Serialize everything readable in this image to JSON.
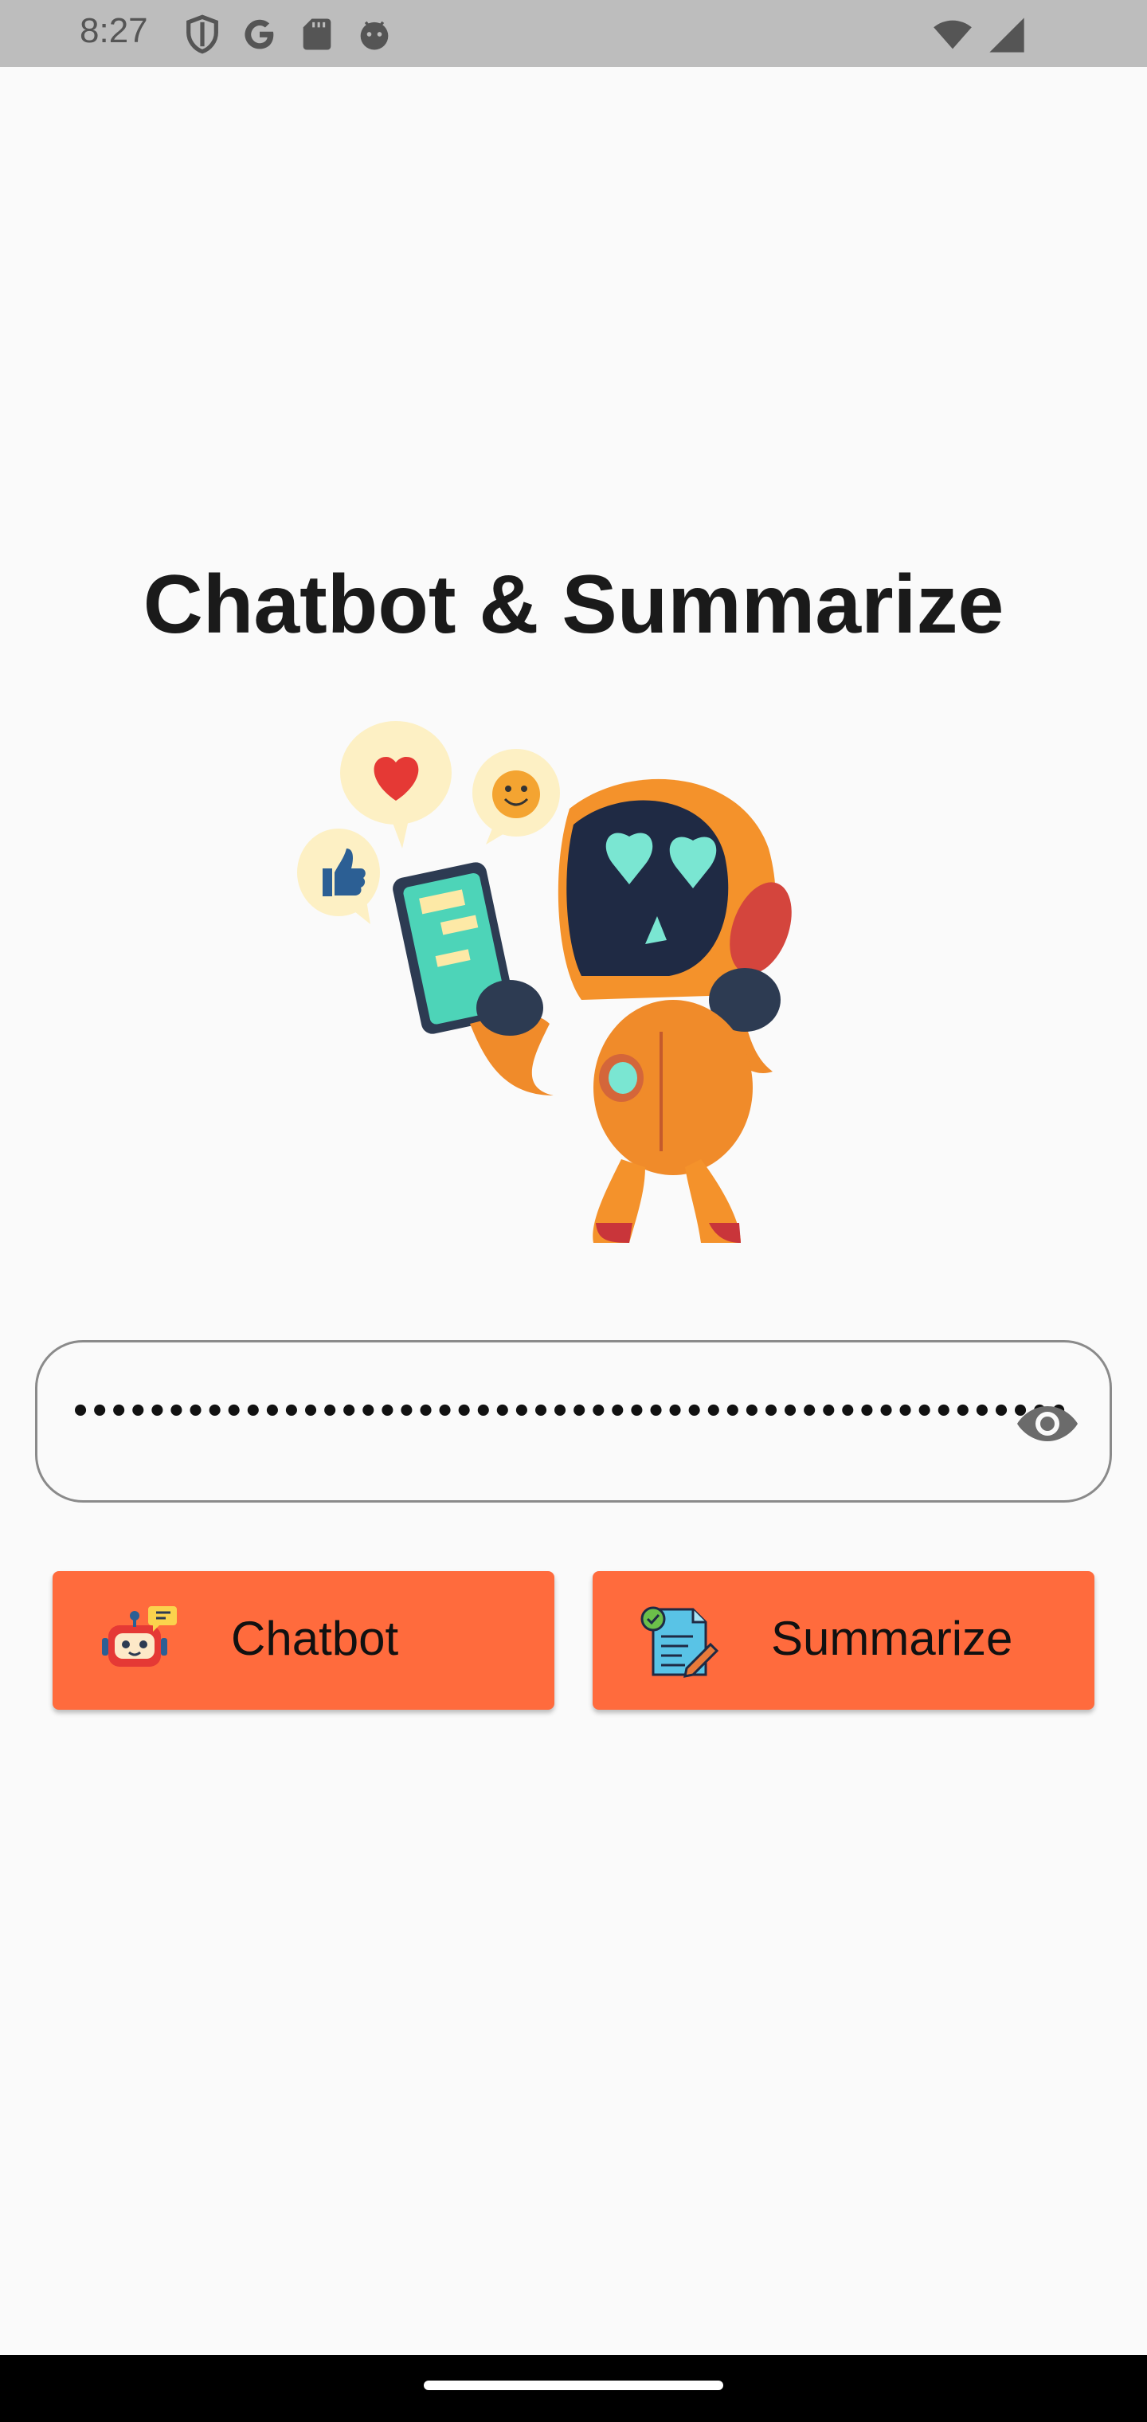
{
  "status_bar": {
    "time": "8:27",
    "left_icons": [
      "shield-icon",
      "google-icon",
      "sd-card-icon",
      "android-debug-icon"
    ],
    "right_icons": [
      "wifi-icon",
      "signal-icon"
    ]
  },
  "main": {
    "title": "Chatbot & Summarize",
    "illustration": "robot-illustration",
    "api_key_field": {
      "masked_value": "••••••••••••••••••••••••••••••••••••••••••••••••••••",
      "visibility_icon": "eye-icon"
    },
    "buttons": {
      "chatbot_label": "Chatbot",
      "summarize_label": "Summarize"
    }
  },
  "colors": {
    "accent": "#ff6b3d",
    "background": "#fafafa",
    "status_bar": "#bdbdbd"
  }
}
